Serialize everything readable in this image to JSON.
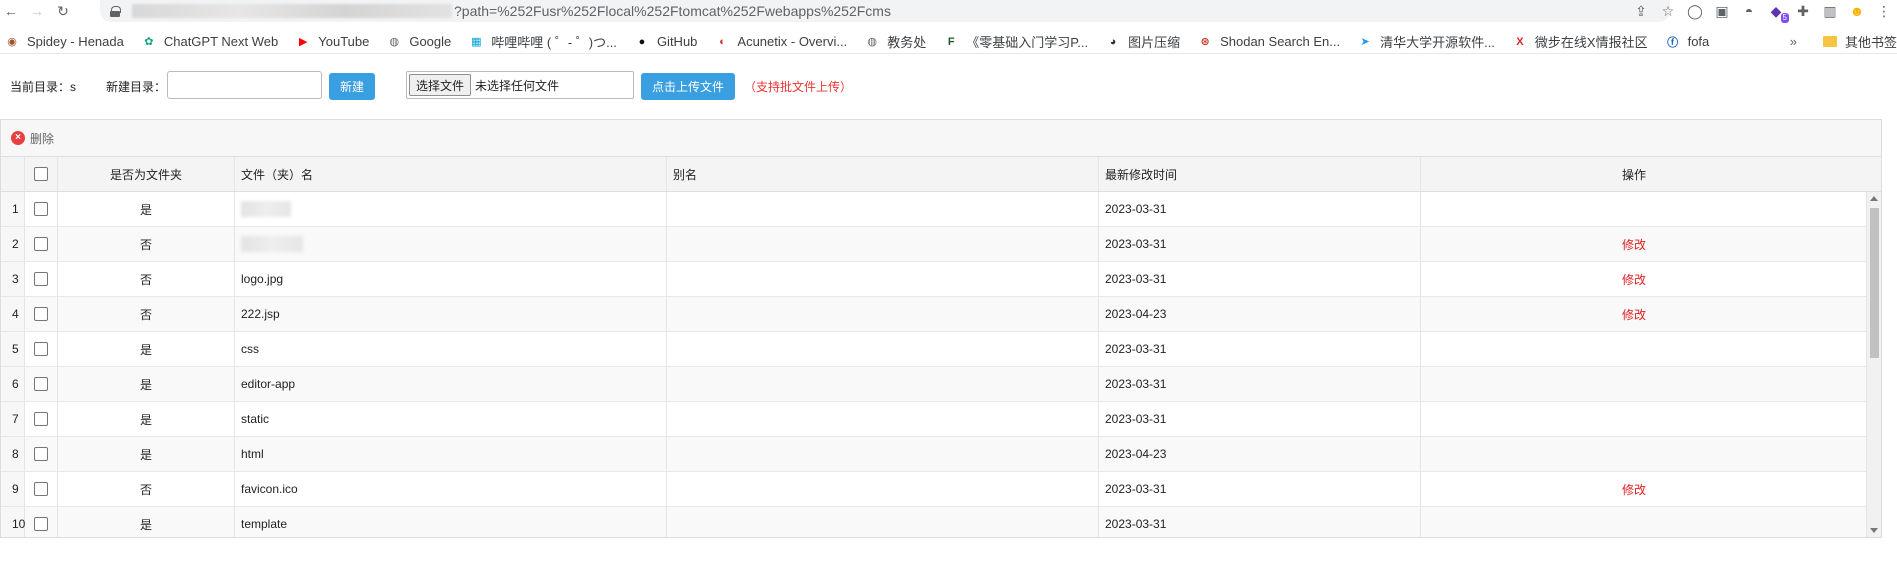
{
  "browser": {
    "url_visible": "?path=%252Fusr%252Flocal%252Ftomcat%252Fwebapps%252Fcms"
  },
  "bookmarks": [
    {
      "label": "Spidey - Henada",
      "icon": "avatar-icon",
      "color": "#a0522d"
    },
    {
      "label": "ChatGPT Next Web",
      "icon": "chatgpt-icon",
      "color": "#10a37f"
    },
    {
      "label": "YouTube",
      "icon": "youtube-icon",
      "color": "#ff0000"
    },
    {
      "label": "Google",
      "icon": "globe-icon",
      "color": "#5f6368"
    },
    {
      "label": "哔哩哔哩 ( ゜- ゜)つ...",
      "icon": "bilibili-icon",
      "color": "#00a1d6"
    },
    {
      "label": "GitHub",
      "icon": "github-icon",
      "color": "#111111"
    },
    {
      "label": "Acunetix - Overvi...",
      "icon": "acunetix-icon",
      "color": "#c0392b"
    },
    {
      "label": "教务处",
      "icon": "globe-icon",
      "color": "#5f6368"
    },
    {
      "label": "《零基础入门学习P...",
      "icon": "fc-icon",
      "color": "#1b5e20"
    },
    {
      "label": "图片压缩",
      "icon": "panda-icon",
      "color": "#333333"
    },
    {
      "label": "Shodan Search En...",
      "icon": "shodan-icon",
      "color": "#c0392b"
    },
    {
      "label": "清华大学开源软件...",
      "icon": "tsinghua-icon",
      "color": "#2196f3"
    },
    {
      "label": "微步在线X情报社区",
      "icon": "x-icon",
      "color": "#e02020"
    },
    {
      "label": "fofa",
      "icon": "fofa-icon",
      "color": "#1565c0"
    }
  ],
  "bookmarks_more": "»",
  "other_bookmarks": "其他书签",
  "upload": {
    "current_dir_label": "当前目录：s",
    "new_dir_label": "新建目录：",
    "new_dir_value": "",
    "new_button": "新建",
    "choose_file_button": "选择文件",
    "file_status": "未选择任何文件",
    "upload_button": "点击上传文件",
    "hint": "（支持批文件上传）"
  },
  "toolbar": {
    "delete_label": "删除"
  },
  "table": {
    "headers": {
      "is_folder": "是否为文件夹",
      "name": "文件（夹）名",
      "alias": "别名",
      "modified": "最新修改时间",
      "action": "操作"
    },
    "rows": [
      {
        "num": "1",
        "is_folder": "是",
        "name": "",
        "name_redacted": true,
        "modified": "2023-03-31",
        "action": ""
      },
      {
        "num": "2",
        "is_folder": "否",
        "name": "",
        "name_redacted": true,
        "modified": "2023-03-31",
        "action": "修改"
      },
      {
        "num": "3",
        "is_folder": "否",
        "name": "logo.jpg",
        "name_redacted": false,
        "modified": "2023-03-31",
        "action": "修改"
      },
      {
        "num": "4",
        "is_folder": "否",
        "name": "222.jsp",
        "name_redacted": false,
        "modified": "2023-04-23",
        "action": "修改"
      },
      {
        "num": "5",
        "is_folder": "是",
        "name": "css",
        "name_redacted": false,
        "modified": "2023-03-31",
        "action": ""
      },
      {
        "num": "6",
        "is_folder": "是",
        "name": "editor-app",
        "name_redacted": false,
        "modified": "2023-03-31",
        "action": ""
      },
      {
        "num": "7",
        "is_folder": "是",
        "name": "static",
        "name_redacted": false,
        "modified": "2023-03-31",
        "action": ""
      },
      {
        "num": "8",
        "is_folder": "是",
        "name": "html",
        "name_redacted": false,
        "modified": "2023-04-23",
        "action": ""
      },
      {
        "num": "9",
        "is_folder": "否",
        "name": "favicon.ico",
        "name_redacted": false,
        "modified": "2023-03-31",
        "action": "修改"
      },
      {
        "num": "10",
        "is_folder": "是",
        "name": "template",
        "name_redacted": false,
        "modified": "2023-03-31",
        "action": ""
      }
    ]
  },
  "colors": {
    "accent": "#3a9fe0",
    "danger": "#e02020"
  }
}
